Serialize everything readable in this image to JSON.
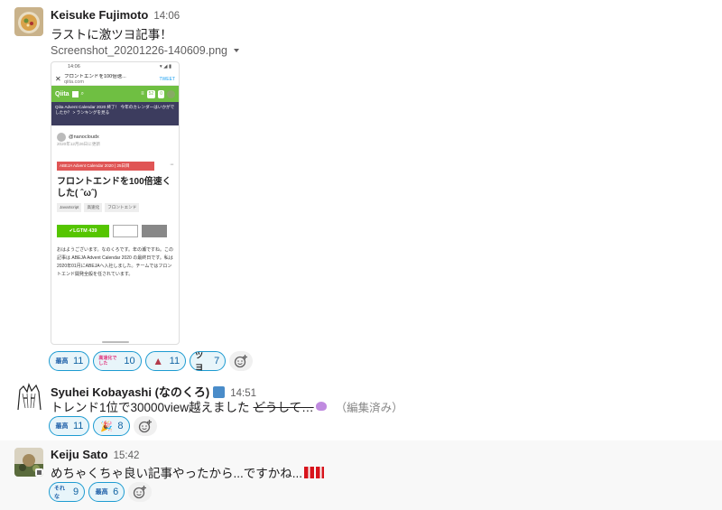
{
  "messages": [
    {
      "author": "Keisuke Fujimoto",
      "time": "14:06",
      "text": "ラストに激ツヨ記事！",
      "file": {
        "name": "Screenshot_20201226-140609.png",
        "preview": {
          "status_time": "14:06",
          "url_title": "フロントエンドを100倍速...",
          "url_host": "qiita.com",
          "tweet": "TWEET",
          "logo": "Qiita",
          "pill_1": "52",
          "pill_2": "0",
          "banner": "Qiita Advent Calendar 2020 終了！ 今年のカレンダーはいかがでしたか？ > ランキングを見る",
          "author": "@nanocloudx",
          "date": "2020年12月26日に更新",
          "tag": "ABEJA Advent Calendar 2020 | 25日目",
          "title": "フロントエンドを100倍速くした( ˆωˆ)",
          "chips": [
            "JavaScript",
            "高速化",
            "フロントエンド"
          ],
          "lgtm": "✔LGTM  439",
          "body": "おはようございます。なのくろです。年の瀬ですね。この記事は ABEJA Advent Calendar 2020 の最終日です。私は2020年01月にABEJAへ入社しました。チームではフロントエンド開発全般を任されています。"
        }
      },
      "reactions": [
        {
          "emoji": "kami-icon",
          "glyph": "最高",
          "count": "11"
        },
        {
          "emoji": "kousokuka-icon",
          "glyph": "高速化でした",
          "count": "10"
        },
        {
          "emoji": "tent-icon",
          "glyph": "▲",
          "count": "11"
        },
        {
          "emoji": "tsuyo-icon",
          "glyph": "ツヨ",
          "count": "7"
        }
      ]
    },
    {
      "author": "Syuhei Kobayashi (なのくろ)",
      "time": "14:51",
      "text": "トレンド1位で30000view越えました",
      "strike": "どうして…",
      "edited": "（編集済み）",
      "reactions": [
        {
          "emoji": "kami-icon",
          "glyph": "最高",
          "count": "11"
        },
        {
          "emoji": "party-icon",
          "glyph": "🎉",
          "count": "8"
        }
      ]
    },
    {
      "author": "Keiju Sato",
      "time": "15:42",
      "text": "めちゃくちゃ良い記事やったから...ですかね...",
      "reactions": [
        {
          "emoji": "sorena-icon",
          "glyph": "それな",
          "count": "9"
        },
        {
          "emoji": "kami-icon",
          "glyph": "最高",
          "count": "6"
        }
      ]
    }
  ],
  "colors": {
    "reaction_border": "#1d9bd1",
    "reaction_bg": "#e8f5fa",
    "qiita_green": "#6fbf42"
  }
}
